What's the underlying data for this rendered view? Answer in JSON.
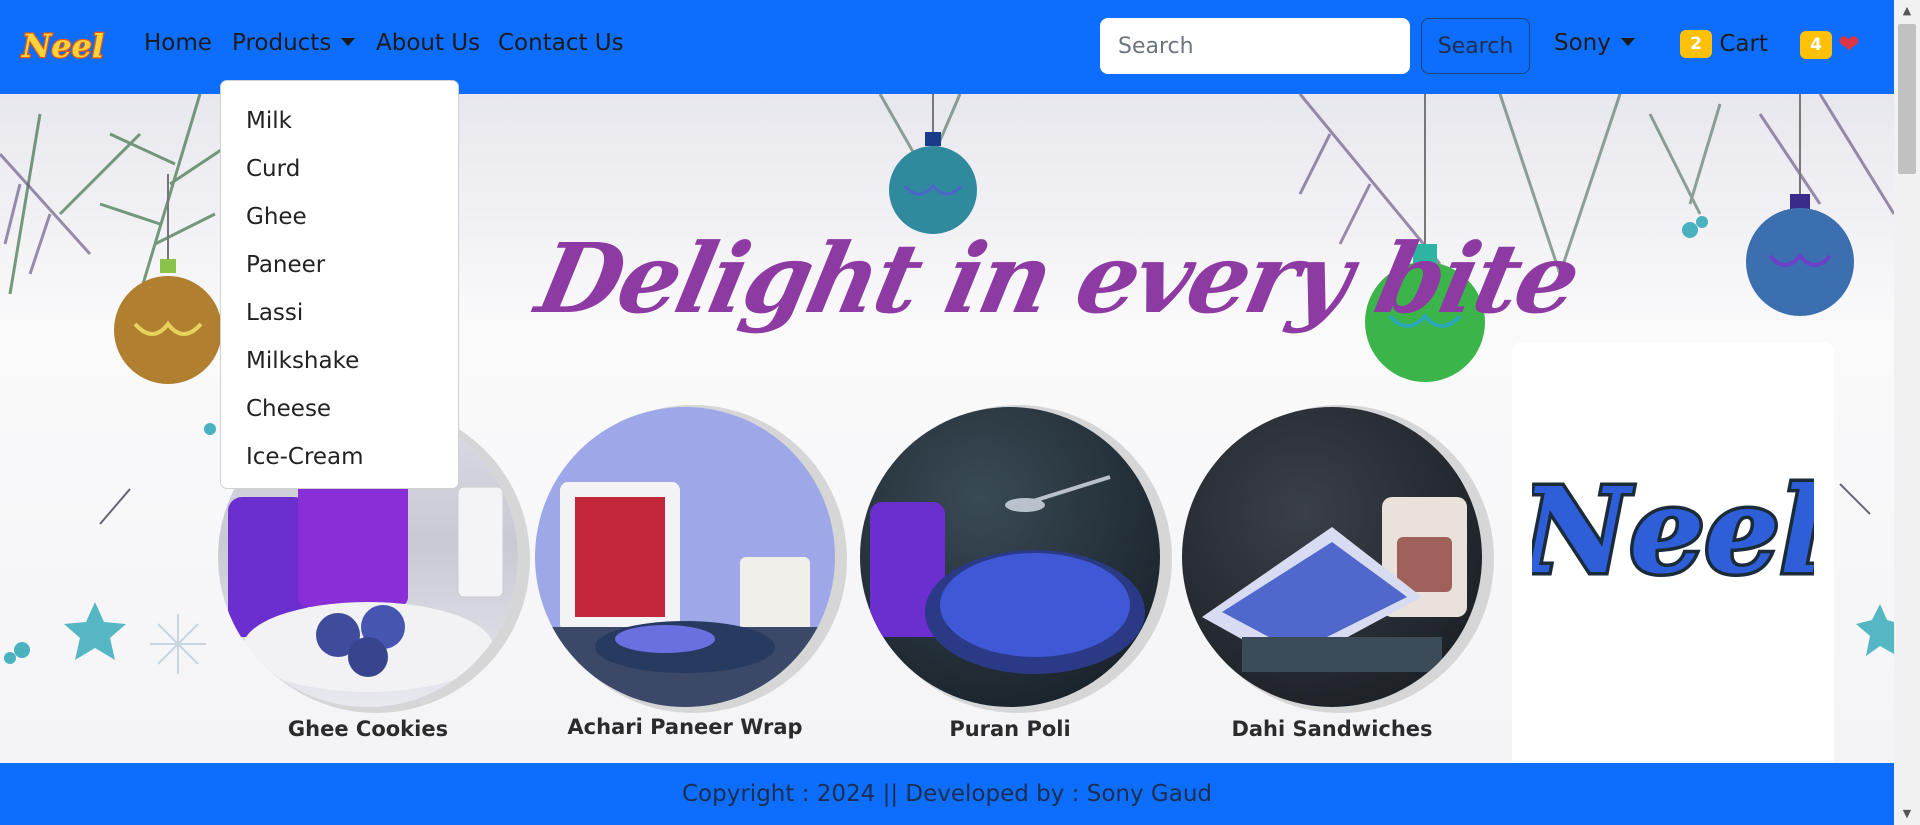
{
  "navbar": {
    "brand": "Neel",
    "links": [
      "Home",
      "Products",
      "About Us",
      "Contact Us"
    ],
    "search": {
      "placeholder": "Search",
      "button": "Search"
    },
    "user": "Sony",
    "cart": {
      "count": "2",
      "label": "Cart"
    },
    "wishlist": {
      "count": "4",
      "icon": "heart-icon"
    }
  },
  "dropdown": {
    "items": [
      "Milk",
      "Curd",
      "Ghee",
      "Paneer",
      "Lassi",
      "Milkshake",
      "Cheese",
      "Ice-Cream"
    ]
  },
  "hero": {
    "headline": "Delight in every bite",
    "products": [
      "Ghee Cookies",
      "Achari Paneer Wrap",
      "Puran Poli",
      "Dahi Sandwiches"
    ],
    "logo": "Neel"
  },
  "footer": {
    "text": "Copyright : 2024 || Developed by : Sony Gaud"
  },
  "colors": {
    "primary": "#0d6efd",
    "badge": "#ffc107",
    "heart": "#dc3545",
    "headline": "#8e3aa3"
  }
}
